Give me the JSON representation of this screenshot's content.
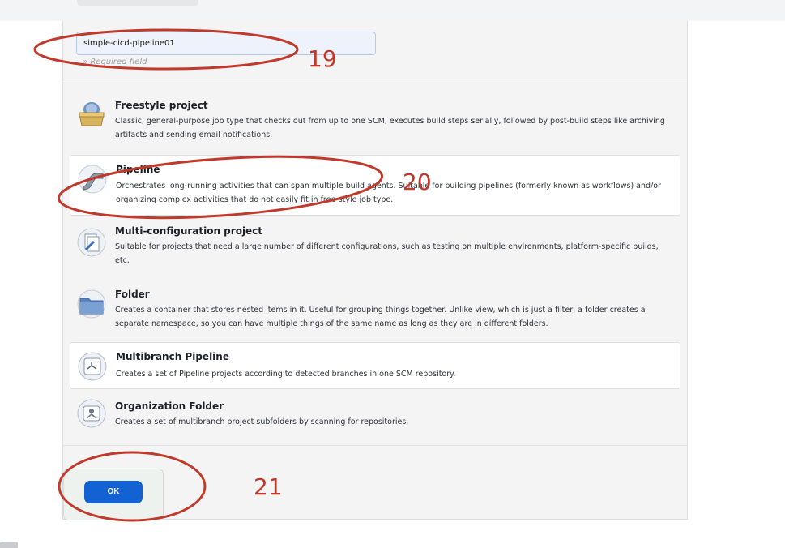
{
  "form": {
    "item_name_value": "simple-cicd-pipeline01",
    "required_note": "» Required field"
  },
  "item_types": [
    {
      "title": "Freestyle project",
      "description": "Classic, general-purpose job type that checks out from up to one SCM, executes build steps serially, followed by post-build steps like archiving artifacts and sending email notifications.",
      "icon": "freestyle-box-icon"
    },
    {
      "title": "Pipeline",
      "description": "Orchestrates long-running activities that can span multiple build agents. Suitable for building pipelines (formerly known as workflows) and/or organizing complex activities that do not easily fit in free-style job type.",
      "icon": "pipeline-pipe-icon"
    },
    {
      "title": "Multi-configuration project",
      "description": "Suitable for projects that need a large number of different configurations, such as testing on multiple environments, platform-specific builds, etc.",
      "icon": "multi-config-icon"
    },
    {
      "title": "Folder",
      "description": "Creates a container that stores nested items in it. Useful for grouping things together. Unlike view, which is just a filter, a folder creates a separate namespace, so you can have multiple things of the same name as long as they are in different folders.",
      "icon": "folder-icon"
    },
    {
      "title": "Multibranch Pipeline",
      "description": "Creates a set of Pipeline projects according to detected branches in one SCM repository.",
      "icon": "multibranch-icon"
    },
    {
      "title": "Organization Folder",
      "description": "Creates a set of multibranch project subfolders by scanning for repositories.",
      "icon": "organization-folder-icon"
    }
  ],
  "footer": {
    "ok_label": "OK"
  },
  "annotations": {
    "step_19": "19",
    "step_20": "20",
    "step_21": "21",
    "color": "#c1392b"
  }
}
